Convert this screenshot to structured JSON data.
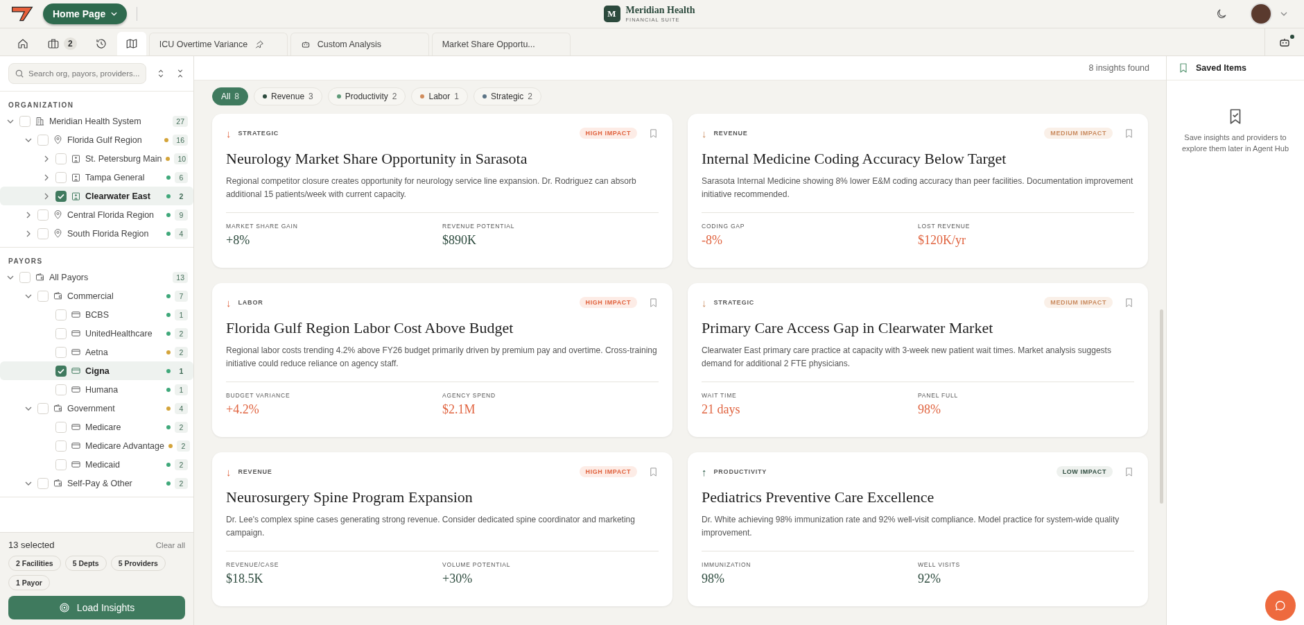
{
  "header": {
    "home_button": "Home Page",
    "brand": {
      "initial": "M",
      "name": "Meridian Health",
      "subtitle": "FINANCIAL SUITE"
    }
  },
  "nav_tabs": [
    {
      "kind": "home",
      "selected": false
    },
    {
      "kind": "briefcase",
      "badge": "2",
      "selected": false
    },
    {
      "kind": "history",
      "selected": false
    },
    {
      "kind": "map",
      "selected": true
    },
    {
      "kind": "pinned",
      "label": "ICU Overtime Variance",
      "selected": false
    },
    {
      "kind": "agent",
      "label": "Custom Analysis",
      "selected": false
    },
    {
      "kind": "plain",
      "label": "Market Share Opportu...",
      "selected": false
    }
  ],
  "agent_button": {
    "notification": true
  },
  "sidebar": {
    "search": {
      "placeholder": "Search org, payors, providers..."
    },
    "sections": [
      {
        "title": "ORGANIZATION",
        "nodes": [
          {
            "label": "Meridian Health System",
            "kind": "building",
            "checked": false,
            "selected": false,
            "expanded": true,
            "count": "27",
            "children": [
              {
                "label": "Florida Gulf Region",
                "kind": "pin",
                "checked": false,
                "selected": false,
                "expanded": true,
                "count": "16",
                "color": "#d4a43a",
                "children": [
                  {
                    "label": "St. Petersburg Main",
                    "kind": "hospital",
                    "checked": false,
                    "selected": false,
                    "expanded": false,
                    "count": "10",
                    "color": "#d4a43a"
                  },
                  {
                    "label": "Tampa General",
                    "kind": "hospital",
                    "checked": false,
                    "selected": false,
                    "expanded": false,
                    "count": "6",
                    "color": "#3fa87a"
                  },
                  {
                    "label": "Clearwater East",
                    "kind": "hospital",
                    "checked": true,
                    "selected": true,
                    "expanded": false,
                    "count": "2",
                    "color": "#3fa87a"
                  }
                ]
              },
              {
                "label": "Central Florida Region",
                "kind": "pin",
                "checked": false,
                "selected": false,
                "expanded": false,
                "count": "9",
                "color": "#3fa87a"
              },
              {
                "label": "South Florida Region",
                "kind": "pin",
                "checked": false,
                "selected": false,
                "expanded": false,
                "count": "4",
                "color": "#3fa87a"
              }
            ]
          }
        ]
      },
      {
        "title": "PAYORS",
        "nodes": [
          {
            "label": "All Payors",
            "kind": "wallet",
            "checked": false,
            "selected": false,
            "expanded": true,
            "count": "13",
            "children": [
              {
                "label": "Commercial",
                "kind": "wallet",
                "checked": false,
                "selected": false,
                "expanded": true,
                "count": "7",
                "color": "#3fa87a",
                "children": [
                  {
                    "label": "BCBS",
                    "kind": "card",
                    "checked": false,
                    "selected": false,
                    "count": "1",
                    "color": "#3fa87a"
                  },
                  {
                    "label": "UnitedHealthcare",
                    "kind": "card",
                    "checked": false,
                    "selected": false,
                    "count": "2",
                    "color": "#3fa87a"
                  },
                  {
                    "label": "Aetna",
                    "kind": "card",
                    "checked": false,
                    "selected": false,
                    "count": "2",
                    "color": "#d4a43a"
                  },
                  {
                    "label": "Cigna",
                    "kind": "card",
                    "checked": true,
                    "selected": true,
                    "count": "1",
                    "color": "#3fa87a"
                  },
                  {
                    "label": "Humana",
                    "kind": "card",
                    "checked": false,
                    "selected": false,
                    "count": "1",
                    "color": "#3fa87a"
                  }
                ]
              },
              {
                "label": "Government",
                "kind": "wallet",
                "checked": false,
                "selected": false,
                "expanded": true,
                "count": "4",
                "color": "#d4a43a",
                "children": [
                  {
                    "label": "Medicare",
                    "kind": "card",
                    "checked": false,
                    "selected": false,
                    "count": "2",
                    "color": "#3fa87a"
                  },
                  {
                    "label": "Medicare Advantage",
                    "kind": "card",
                    "checked": false,
                    "selected": false,
                    "count": "2",
                    "color": "#d4a43a"
                  },
                  {
                    "label": "Medicaid",
                    "kind": "card",
                    "checked": false,
                    "selected": false,
                    "count": "2",
                    "color": "#3fa87a"
                  }
                ]
              },
              {
                "label": "Self-Pay & Other",
                "kind": "wallet",
                "checked": false,
                "selected": false,
                "expanded": true,
                "count": "2",
                "color": "#3fa87a"
              }
            ]
          }
        ]
      }
    ],
    "footer": {
      "selected_count": "13 selected",
      "clear": "Clear all",
      "chips": [
        "2 Facilities",
        "5 Depts",
        "5 Providers",
        "1 Payor"
      ],
      "load_button": "Load Insights"
    }
  },
  "main": {
    "result_count": "8 insights found",
    "filters": [
      {
        "label": "All",
        "count": "8",
        "selected": true
      },
      {
        "label": "Revenue",
        "count": "3",
        "color": "#2c4a3d",
        "selected": false
      },
      {
        "label": "Productivity",
        "count": "2",
        "color": "#5e9a78",
        "selected": false
      },
      {
        "label": "Labor",
        "count": "1",
        "color": "#d08c5c",
        "selected": false
      },
      {
        "label": "Strategic",
        "count": "2",
        "color": "#5b7385",
        "selected": false
      }
    ],
    "cards": [
      {
        "kind": "high",
        "arrow": "↓",
        "category": "STRATEGIC",
        "impact": "HIGH IMPACT",
        "title": "Neurology Market Share Opportunity in Sarasota",
        "description": "Regional competitor closure creates opportunity for neurology service line expansion. Dr. Rodriguez can absorb additional 15 patients/week with current capacity.",
        "metrics": [
          {
            "kind": "neutral",
            "label": "MARKET SHARE GAIN",
            "value": "+8%"
          },
          {
            "kind": "neutral",
            "label": "REVENUE POTENTIAL",
            "value": "$890K"
          }
        ]
      },
      {
        "kind": "medium",
        "arrow": "↓",
        "category": "REVENUE",
        "impact": "MEDIUM IMPACT",
        "title": "Internal Medicine Coding Accuracy Below Target",
        "description": "Sarasota Internal Medicine showing 8% lower E&M coding accuracy than peer facilities. Documentation improvement initiative recommended.",
        "metrics": [
          {
            "kind": "negative",
            "label": "CODING GAP",
            "value": "-8%"
          },
          {
            "kind": "negative",
            "label": "LOST REVENUE",
            "value": "$120K/yr"
          }
        ]
      },
      {
        "kind": "high",
        "arrow": "↓",
        "category": "LABOR",
        "impact": "HIGH IMPACT",
        "title": "Florida Gulf Region Labor Cost Above Budget",
        "description": "Regional labor costs trending 4.2% above FY26 budget primarily driven by premium pay and overtime. Cross-training initiative could reduce reliance on agency staff.",
        "metrics": [
          {
            "kind": "negative",
            "label": "BUDGET VARIANCE",
            "value": "+4.2%"
          },
          {
            "kind": "negative",
            "label": "AGENCY SPEND",
            "value": "$2.1M"
          }
        ]
      },
      {
        "kind": "medium",
        "arrow": "↓",
        "category": "STRATEGIC",
        "impact": "MEDIUM IMPACT",
        "title": "Primary Care Access Gap in Clearwater Market",
        "description": "Clearwater East primary care practice at capacity with 3-week new patient wait times. Market analysis suggests demand for additional 2 FTE physicians.",
        "metrics": [
          {
            "kind": "negative",
            "label": "WAIT TIME",
            "value": "21 days"
          },
          {
            "kind": "negative",
            "label": "PANEL FULL",
            "value": "98%"
          }
        ]
      },
      {
        "kind": "high",
        "arrow": "↓",
        "category": "REVENUE",
        "impact": "HIGH IMPACT",
        "title": "Neurosurgery Spine Program Expansion",
        "description": "Dr. Lee's complex spine cases generating strong revenue. Consider dedicated spine coordinator and marketing campaign.",
        "metrics": [
          {
            "kind": "neutral",
            "label": "REVENUE/CASE",
            "value": "$18.5K"
          },
          {
            "kind": "neutral",
            "label": "VOLUME POTENTIAL",
            "value": "+30%"
          }
        ]
      },
      {
        "kind": "low",
        "arrow": "↑",
        "category": "PRODUCTIVITY",
        "impact": "LOW IMPACT",
        "title": "Pediatrics Preventive Care Excellence",
        "description": "Dr. White achieving 98% immunization rate and 92% well-visit compliance. Model practice for system-wide quality improvement.",
        "metrics": [
          {
            "kind": "neutral",
            "label": "IMMUNIZATION",
            "value": "98%"
          },
          {
            "kind": "neutral",
            "label": "WELL VISITS",
            "value": "92%"
          }
        ]
      }
    ]
  },
  "saved_panel": {
    "title": "Saved Items",
    "empty_text": "Save insights and providers to explore them later in Agent Hub"
  }
}
